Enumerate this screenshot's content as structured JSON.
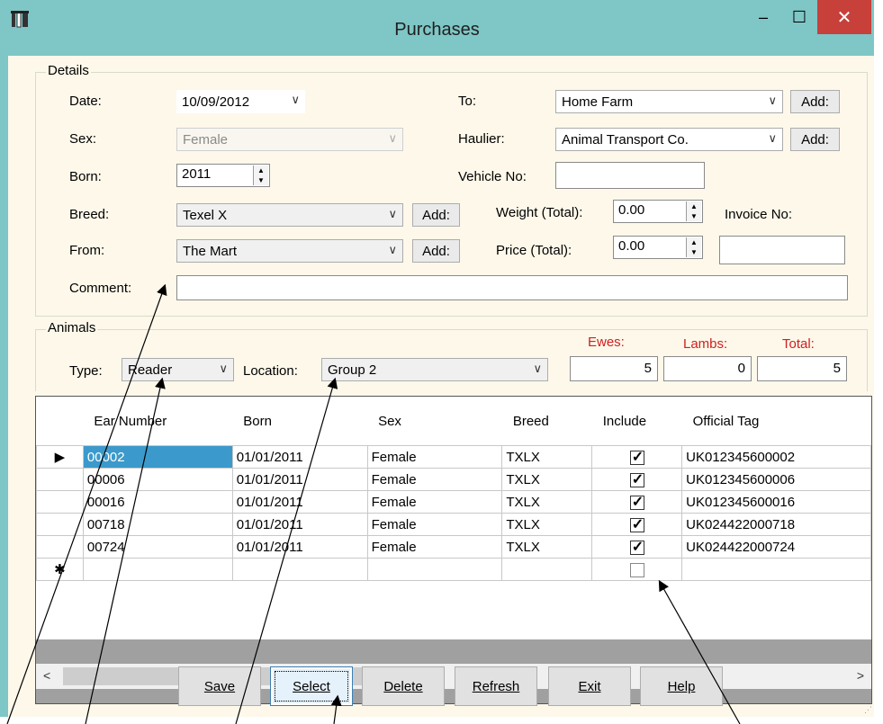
{
  "window": {
    "title": "Purchases",
    "minimize": "–",
    "maximize": "☐",
    "close": "✕"
  },
  "details": {
    "legend": "Details",
    "date_label": "Date:",
    "date_value": "10/09/2012",
    "sex_label": "Sex:",
    "sex_value": "Female",
    "born_label": "Born:",
    "born_value": "2011",
    "breed_label": "Breed:",
    "breed_value": "Texel X",
    "breed_add": "Add:",
    "from_label": "From:",
    "from_value": "The Mart",
    "from_add": "Add:",
    "comment_label": "Comment:",
    "comment_value": "",
    "to_label": "To:",
    "to_value": "Home Farm",
    "to_add": "Add:",
    "haulier_label": "Haulier:",
    "haulier_value": "Animal Transport Co.",
    "haulier_add": "Add:",
    "vehicle_label": "Vehicle No:",
    "vehicle_value": "",
    "weight_label": "Weight (Total):",
    "weight_value": "0.00",
    "price_label": "Price (Total):",
    "price_value": "0.00",
    "invoice_label": "Invoice No:",
    "invoice_value": ""
  },
  "animals": {
    "legend": "Animals",
    "type_label": "Type:",
    "type_value": "Reader",
    "location_label": "Location:",
    "location_value": "Group 2",
    "ewes_label": "Ewes:",
    "ewes_value": "5",
    "lambs_label": "Lambs:",
    "lambs_value": "0",
    "total_label": "Total:",
    "total_value": "5"
  },
  "grid": {
    "columns": [
      "Ear Number",
      "Born",
      "Sex",
      "Breed",
      "Include",
      "Official Tag"
    ],
    "rows": [
      {
        "ear": "00002",
        "born": "01/01/2011",
        "sex": "Female",
        "breed": "TXLX",
        "include": true,
        "tag": "UK012345600002"
      },
      {
        "ear": "00006",
        "born": "01/01/2011",
        "sex": "Female",
        "breed": "TXLX",
        "include": true,
        "tag": "UK012345600006"
      },
      {
        "ear": "00016",
        "born": "01/01/2011",
        "sex": "Female",
        "breed": "TXLX",
        "include": true,
        "tag": "UK012345600016"
      },
      {
        "ear": "00718",
        "born": "01/01/2011",
        "sex": "Female",
        "breed": "TXLX",
        "include": true,
        "tag": "UK024422000718"
      },
      {
        "ear": "00724",
        "born": "01/01/2011",
        "sex": "Female",
        "breed": "TXLX",
        "include": true,
        "tag": "UK024422000724"
      }
    ],
    "current_marker": "▶",
    "new_row_marker": "✱"
  },
  "buttons": {
    "save": "Save",
    "select": "Select",
    "delete": "Delete",
    "refresh": "Refresh",
    "exit": "Exit",
    "help": "Help"
  },
  "icons": {
    "app": "sheep-icon",
    "dropdown": "chevron-down-icon",
    "spin": "spin-up-down-icon"
  }
}
